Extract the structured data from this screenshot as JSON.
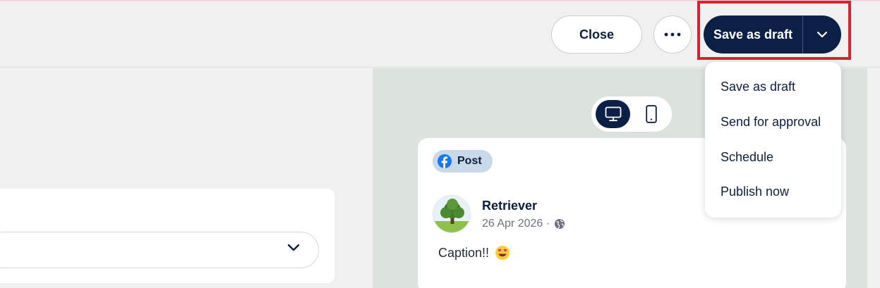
{
  "header": {
    "close_label": "Close",
    "more_icon": "ellipsis-icon",
    "primary_action_label": "Save as draft",
    "primary_caret_icon": "chevron-down-icon"
  },
  "dropdown": {
    "items": [
      {
        "label": "Save as draft"
      },
      {
        "label": "Send for approval"
      },
      {
        "label": "Schedule"
      },
      {
        "label": "Publish now"
      }
    ]
  },
  "preview": {
    "device_options": [
      "desktop-icon",
      "mobile-icon"
    ],
    "selected_device": "desktop",
    "badge_label": "Post",
    "badge_icon": "facebook-icon",
    "author_name": "Retriever",
    "post_date": "26 Apr 2026 ·",
    "visibility_icon": "globe-icon",
    "caption": "Caption!!",
    "caption_emoji_icon": "heart-eyes-emoji-icon"
  },
  "colors": {
    "brand_navy": "#0b1f47",
    "highlight_red": "#d62331",
    "preview_bg": "#dce3df",
    "facebook_blue": "#1877f2",
    "badge_bg": "#c9d9ea"
  }
}
